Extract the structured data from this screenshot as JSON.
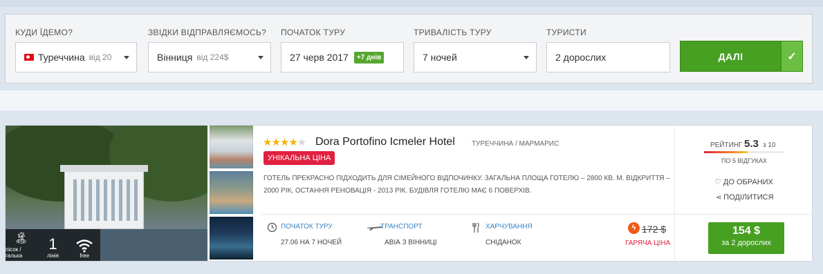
{
  "search": {
    "destination": {
      "label": "КУДИ ЇДЕМО?",
      "value": "Туреччина",
      "sub": "від 20"
    },
    "departure": {
      "label": "ЗВІДКИ ВІДПРАВЛЯЄМОСЬ?",
      "value": "Вінниця",
      "sub": "від 224$"
    },
    "start": {
      "label": "ПОЧАТОК ТУРУ",
      "value": "27 черв 2017",
      "badge": "+7 днів"
    },
    "duration": {
      "label": "ТРИВАЛІСТЬ ТУРУ",
      "value": "7 ночей"
    },
    "tourists": {
      "label": "ТУРИСТИ",
      "value": "2 дорослих"
    },
    "go_label": "ДАЛІ",
    "go_check": "✓"
  },
  "hotel": {
    "stars_on": "★★★★",
    "stars_off": "★",
    "name": "Dora Portofino Icmeler Hotel",
    "location": "ТУРЕЧЧИНА / МАРМАРИС",
    "unique_badge": "УНІКАЛЬНА ЦІНА",
    "description": "ГОТЕЛЬ ПРЕКРАСНО ПІДХОДИТЬ ДЛЯ СІМЕЙНОГО ВІДПОЧИНКУ. ЗАГАЛЬНА ПЛОЩА ГОТЕЛЮ – 2800 КВ. М. ВІДКРИТТЯ – 2000 РІК, ОСТАННЯ РЕНОВАЦІЯ - 2013 РІК. БУДІВЛЯ ГОТЕЛЮ МАЄ 6 ПОВЕРХІВ.",
    "amenities": {
      "beach_label": "пісок / галька",
      "line_num": "1",
      "line_label": "лінія",
      "wifi_label": "free"
    },
    "tour_start": {
      "label": "ПОЧАТОК ТУРУ",
      "value": "27.06 НА 7 НОЧЕЙ"
    },
    "transport": {
      "label": "ТРАНСПОРТ",
      "value": "АВІА З ВІННИЦІ"
    },
    "meals": {
      "label": "ХАРЧУВАННЯ",
      "value": "СНІДАНОК"
    },
    "old_price": "172 $",
    "hot_label": "ГАРЯЧА ЦІНА",
    "rating_label": "РЕЙТИНГ",
    "rating_value": "5.3",
    "rating_of": "з 10",
    "rating_fraction": 0.53,
    "reviews": "ПО 5 ВІДГУКАХ",
    "favorites": "♡ ДО ОБРАНИХ",
    "share": "ПОДІЛИТИСЯ",
    "price": "154 $",
    "price_for": "за 2 дорослих"
  },
  "colors": {
    "accent_green": "#47a021",
    "hot_red": "#e1203f",
    "link_blue": "#3a86c4"
  }
}
